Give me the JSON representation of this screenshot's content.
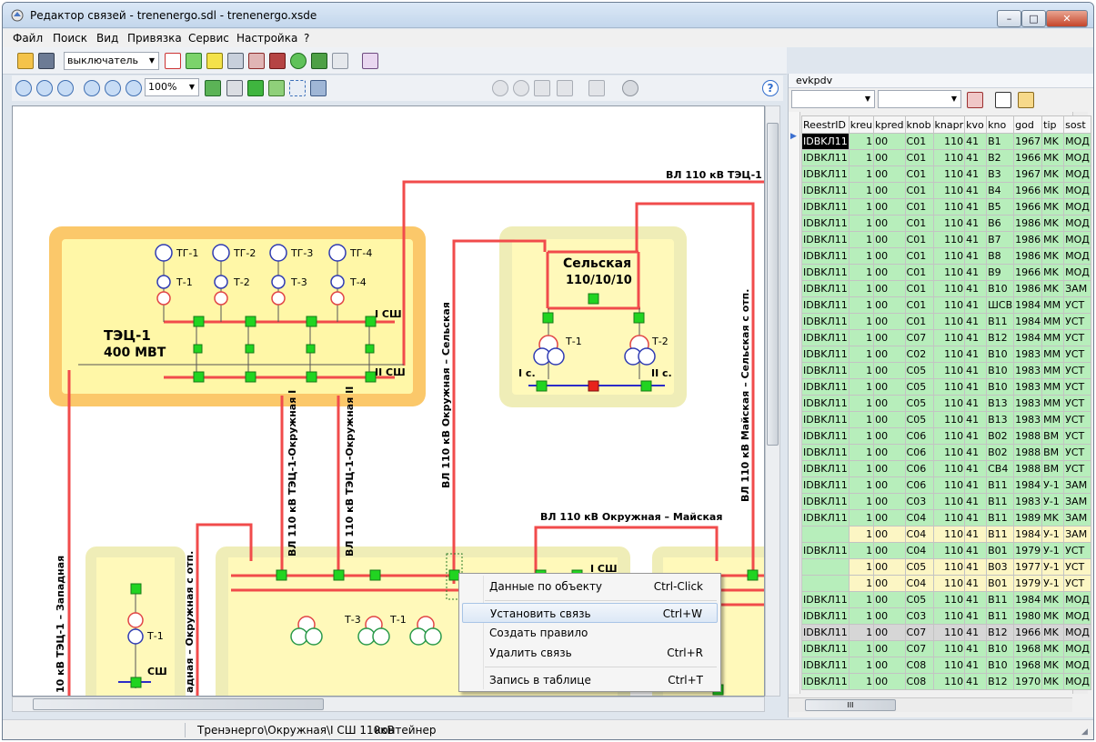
{
  "window": {
    "title": "Редактор связей - trenenergo.sdl - trenenergo.xsde",
    "min_label": "–",
    "max_label": "□",
    "close_label": "✕"
  },
  "menu": [
    "Файл",
    "Поиск",
    "Вид",
    "Привязка",
    "Сервис",
    "Настройка",
    "?"
  ],
  "toolbar": {
    "element_type": "выключатель",
    "zoom": "100%"
  },
  "diagram": {
    "tec_title": "ТЭЦ-1",
    "tec_power": "400 МВТ",
    "generators": [
      "ТГ-1",
      "ТГ-2",
      "ТГ-3",
      "ТГ-4"
    ],
    "transformers": [
      "Т-1",
      "Т-2",
      "Т-3",
      "Т-4"
    ],
    "bus_1": "I СШ",
    "bus_2": "II СШ",
    "sub_name": "Сельская",
    "sub_voltage": "110/10/10",
    "sub_t1": "Т-1",
    "sub_t2": "Т-2",
    "sub_sec1": "I с.",
    "sub_sec2": "II с.",
    "line_tec": "ВЛ 110 кВ ТЭЦ-1",
    "line_tec_okr1": "ВЛ 110 кВ ТЭЦ-1-Окружная I",
    "line_tec_okr2": "ВЛ 110 кВ ТЭЦ-1-Окружная II",
    "line_okr_sel": "ВЛ 110 кВ Окружная – Сельская",
    "line_maj_sel": "ВЛ 110 кВ Майская – Сельская с отп.",
    "line_okr_maj": "ВЛ 110 кВ Окружная – Майская",
    "line_west": "10 кВ ТЭЦ-1 – Западная",
    "line_west_okr": "адная – Окружная с отп.",
    "bottom_t1": "Т-1",
    "bottom_t3": "Т-3",
    "bottom_t1b": "Т-1",
    "bottom_ssh": "СШ",
    "bottom_bus1": "I СШ"
  },
  "context_menu": {
    "items": [
      {
        "label": "Данные по объекту",
        "shortcut": "Ctrl-Click"
      },
      {
        "label": "Установить связь",
        "shortcut": "Ctrl+W"
      },
      {
        "label": "Создать правило",
        "shortcut": ""
      },
      {
        "label": "Удалить связь",
        "shortcut": "Ctrl+R"
      },
      {
        "label": "Запись в таблице",
        "shortcut": "Ctrl+T"
      }
    ]
  },
  "panel": {
    "title": "evkpdv",
    "columns": [
      "ReestrID",
      "kreu",
      "kpred",
      "knob",
      "knapr",
      "kvo",
      "kno",
      "god",
      "tip",
      "sost"
    ],
    "rows": [
      [
        "IDBKЛ11",
        "1",
        "00",
        "C01",
        "110",
        "41",
        "B1",
        "1967",
        "MK",
        "МОД"
      ],
      [
        "IDBKЛ11",
        "1",
        "00",
        "C01",
        "110",
        "41",
        "B2",
        "1966",
        "MK",
        "МОД"
      ],
      [
        "IDBKЛ11",
        "1",
        "00",
        "C01",
        "110",
        "41",
        "B3",
        "1967",
        "MK",
        "МОД"
      ],
      [
        "IDBKЛ11",
        "1",
        "00",
        "C01",
        "110",
        "41",
        "B4",
        "1966",
        "MK",
        "МОД"
      ],
      [
        "IDBKЛ11",
        "1",
        "00",
        "C01",
        "110",
        "41",
        "B5",
        "1966",
        "MK",
        "МОД"
      ],
      [
        "IDBKЛ11",
        "1",
        "00",
        "C01",
        "110",
        "41",
        "B6",
        "1986",
        "MK",
        "МОД"
      ],
      [
        "IDBKЛ11",
        "1",
        "00",
        "C01",
        "110",
        "41",
        "B7",
        "1986",
        "MK",
        "МОД"
      ],
      [
        "IDBKЛ11",
        "1",
        "00",
        "C01",
        "110",
        "41",
        "B8",
        "1986",
        "MK",
        "МОД"
      ],
      [
        "IDBKЛ11",
        "1",
        "00",
        "C01",
        "110",
        "41",
        "B9",
        "1966",
        "MK",
        "МОД"
      ],
      [
        "IDBKЛ11",
        "1",
        "00",
        "C01",
        "110",
        "41",
        "B10",
        "1986",
        "MK",
        "ЗАМ"
      ],
      [
        "IDBKЛ11",
        "1",
        "00",
        "C01",
        "110",
        "41",
        "ШСВ",
        "1984",
        "MM",
        "УСТ"
      ],
      [
        "IDBKЛ11",
        "1",
        "00",
        "C01",
        "110",
        "41",
        "B11",
        "1984",
        "MM",
        "УСТ"
      ],
      [
        "IDBKЛ11",
        "1",
        "00",
        "C07",
        "110",
        "41",
        "B12",
        "1984",
        "MM",
        "УСТ"
      ],
      [
        "IDBKЛ11",
        "1",
        "00",
        "C02",
        "110",
        "41",
        "B10",
        "1983",
        "MM",
        "УСТ"
      ],
      [
        "IDBKЛ11",
        "1",
        "00",
        "C05",
        "110",
        "41",
        "B10",
        "1983",
        "MM",
        "УСТ"
      ],
      [
        "IDBKЛ11",
        "1",
        "00",
        "C05",
        "110",
        "41",
        "B10",
        "1983",
        "MM",
        "УСТ"
      ],
      [
        "IDBKЛ11",
        "1",
        "00",
        "C05",
        "110",
        "41",
        "B13",
        "1983",
        "MM",
        "УСТ"
      ],
      [
        "IDBKЛ11",
        "1",
        "00",
        "C05",
        "110",
        "41",
        "B13",
        "1983",
        "MM",
        "УСТ"
      ],
      [
        "IDBKЛ11",
        "1",
        "00",
        "C06",
        "110",
        "41",
        "B02",
        "1988",
        "BM",
        "УСТ"
      ],
      [
        "IDBKЛ11",
        "1",
        "00",
        "C06",
        "110",
        "41",
        "B02",
        "1988",
        "BM",
        "УСТ"
      ],
      [
        "IDBKЛ11",
        "1",
        "00",
        "C06",
        "110",
        "41",
        "CB4",
        "1988",
        "BM",
        "УСТ"
      ],
      [
        "IDBKЛ11",
        "1",
        "00",
        "C06",
        "110",
        "41",
        "B11",
        "1984",
        "У-1",
        "ЗАМ"
      ],
      [
        "IDBKЛ11",
        "1",
        "00",
        "C03",
        "110",
        "41",
        "B11",
        "1983",
        "У-1",
        "ЗАМ"
      ],
      [
        "IDBKЛ11",
        "1",
        "00",
        "C04",
        "110",
        "41",
        "B11",
        "1989",
        "MK",
        "ЗАМ"
      ],
      [
        "",
        "1",
        "00",
        "C04",
        "110",
        "41",
        "B11",
        "1984",
        "У-1",
        "ЗАМ"
      ],
      [
        "IDBKЛ11",
        "1",
        "00",
        "C04",
        "110",
        "41",
        "B01",
        "1979",
        "У-1",
        "УСТ"
      ],
      [
        "",
        "1",
        "00",
        "C05",
        "110",
        "41",
        "B03",
        "1977",
        "У-1",
        "УСТ"
      ],
      [
        "",
        "1",
        "00",
        "C04",
        "110",
        "41",
        "B01",
        "1979",
        "У-1",
        "УСТ"
      ],
      [
        "IDBKЛ11",
        "1",
        "00",
        "C05",
        "110",
        "41",
        "B11",
        "1984",
        "MK",
        "МОД"
      ],
      [
        "IDBKЛ11",
        "1",
        "00",
        "C03",
        "110",
        "41",
        "B11",
        "1980",
        "MK",
        "МОД"
      ],
      [
        "IDBKЛ11",
        "1",
        "00",
        "C07",
        "110",
        "41",
        "B12",
        "1966",
        "MK",
        "МОД"
      ],
      [
        "IDBKЛ11",
        "1",
        "00",
        "C07",
        "110",
        "41",
        "B10",
        "1968",
        "MK",
        "МОД"
      ],
      [
        "IDBKЛ11",
        "1",
        "00",
        "C08",
        "110",
        "41",
        "B10",
        "1968",
        "MK",
        "МОД"
      ],
      [
        "IDBKЛ11",
        "1",
        "00",
        "C08",
        "110",
        "41",
        "B12",
        "1970",
        "MK",
        "МОД"
      ]
    ],
    "row_styles": [
      "g",
      "g",
      "g",
      "g",
      "g",
      "g",
      "g",
      "g",
      "g",
      "g",
      "g",
      "g",
      "g",
      "g",
      "g",
      "g",
      "g",
      "g",
      "g",
      "g",
      "g",
      "g",
      "g",
      "g",
      "y",
      "g",
      "y",
      "y",
      "g",
      "g",
      "s",
      "g",
      "g",
      "g"
    ],
    "scroll_grip": "III"
  },
  "status": {
    "path": "Тренэнерго\\Окружная\\I СШ 110кВ",
    "type": "контейнер"
  }
}
